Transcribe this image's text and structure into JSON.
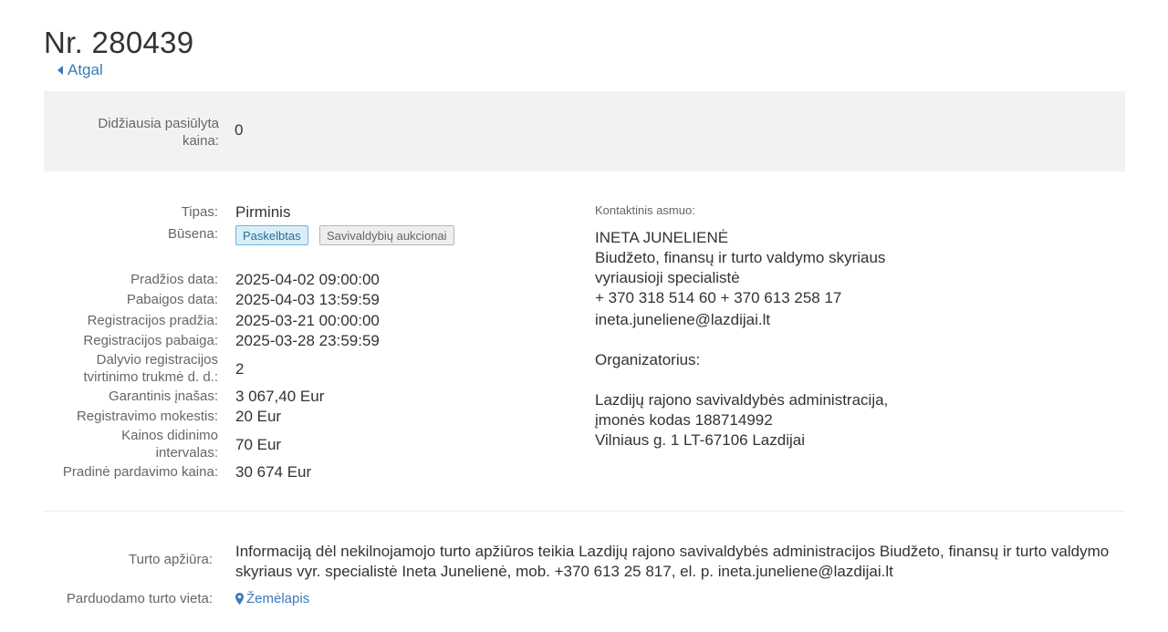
{
  "page": {
    "title": "Nr. 280439",
    "back_label": "Atgal"
  },
  "bid": {
    "label": "Didžiausia pasiūlyta kaina:",
    "value": "0"
  },
  "details": {
    "type_label": "Tipas:",
    "type_value": "Pirminis",
    "status_label": "Būsena:",
    "badges": [
      "Paskelbtas",
      "Savivaldybių aukcionai"
    ],
    "rows": [
      {
        "label": "Pradžios data:",
        "value": "2025-04-02 09:00:00"
      },
      {
        "label": "Pabaigos data:",
        "value": "2025-04-03 13:59:59"
      },
      {
        "label": "Registracijos pradžia:",
        "value": "2025-03-21 00:00:00"
      },
      {
        "label": "Registracijos pabaiga:",
        "value": "2025-03-28 23:59:59"
      },
      {
        "label": "Dalyvio registracijos tvirtinimo trukmė d. d.:",
        "value": "2"
      },
      {
        "label": "Garantinis įnašas:",
        "value": "3 067,40 Eur"
      },
      {
        "label": "Registravimo mokestis:",
        "value": "20 Eur"
      },
      {
        "label": "Kainos didinimo intervalas:",
        "value": "70 Eur"
      },
      {
        "label": "Pradinė pardavimo kaina:",
        "value": "30 674 Eur"
      }
    ]
  },
  "contact": {
    "heading": "Kontaktinis asmuo:",
    "name": "INETA JUNELIENĖ",
    "dept": "Biudžeto, finansų ir turto valdymo skyriaus",
    "position": "vyriausioji specialistė",
    "phones": "+ 370 318 514 60 + 370 613 258 17",
    "email": "ineta.juneliene@lazdijai.lt",
    "organizer_label": "Organizatorius:",
    "org_name": "Lazdijų rajono savivaldybės administracija,",
    "org_code": "įmonės kodas 188714992",
    "org_address": "Vilniaus g. 1 LT-67106 Lazdijai"
  },
  "inspection": {
    "label": "Turto apžiūra:",
    "text": "Informaciją dėl nekilnojamojo turto apžiūros teikia Lazdijų rajono savivaldybės administracijos Biudžeto, finansų ir turto valdymo skyriaus vyr. specialistė Ineta Junelienė, mob. +370 613 25 817, el. p. ineta.juneliene@lazdijai.lt"
  },
  "location": {
    "label": "Parduodamo turto vieta:",
    "link": "Žemėlapis"
  },
  "icons": {
    "back": "caret-left-icon",
    "map": "map-marker-icon"
  },
  "colors": {
    "link": "#3a7ab8",
    "badge_published_bg": "#d9eef8",
    "panel_bg": "#f2f2f2"
  }
}
